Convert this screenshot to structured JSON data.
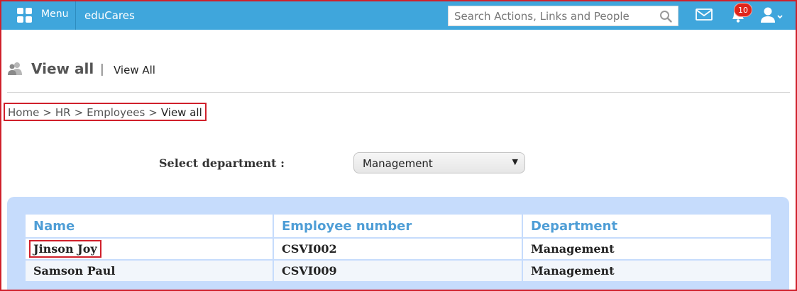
{
  "topbar": {
    "menu_label": "Menu",
    "brand": "eduCares",
    "search_placeholder": "Search Actions, Links and People",
    "notification_count": "10",
    "bar_color": "#3fa6dc",
    "icons": [
      "menu-grid-icon",
      "search-icon",
      "mail-icon",
      "bell-icon",
      "user-icon"
    ]
  },
  "page": {
    "title": "View all",
    "separator": "|",
    "subtitle": "View All"
  },
  "breadcrumb": [
    "Home",
    "HR",
    "Employees",
    "View all"
  ],
  "breadcrumb_separator": ">",
  "filter": {
    "label": "Select department :",
    "selected": "Management"
  },
  "table": {
    "columns": [
      "Name",
      "Employee number",
      "Department"
    ],
    "rows": [
      [
        "Jinson Joy",
        "CSVI002",
        "Management"
      ],
      [
        "Samson Paul",
        "CSVI009",
        "Management"
      ]
    ]
  },
  "colors": {
    "highlight": "#d0202b",
    "header_text": "#4f9ed6",
    "panel": "#c6dcfc",
    "badge": "#e0251b"
  }
}
